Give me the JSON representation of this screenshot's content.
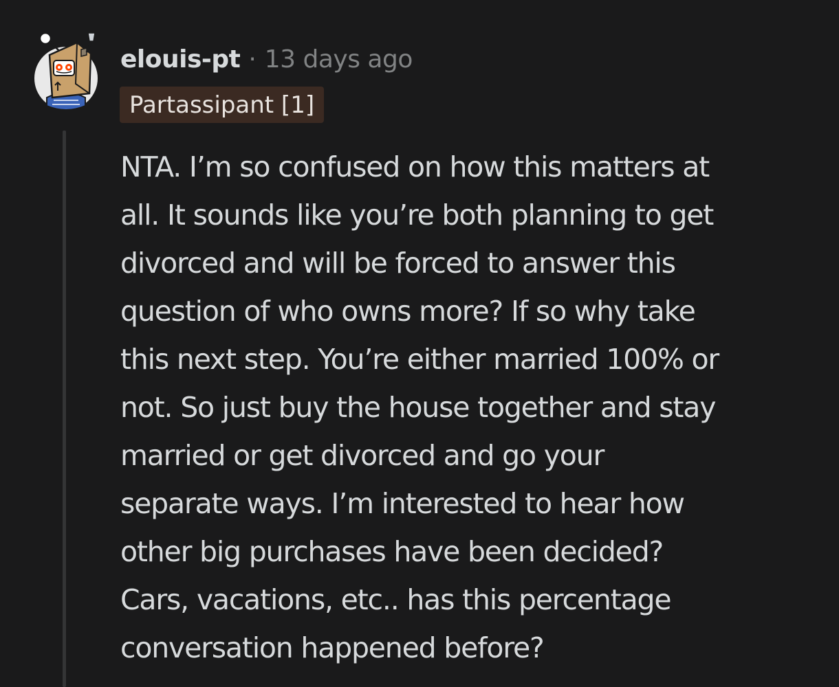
{
  "comment": {
    "author": "elouis-pt",
    "separator": "·",
    "time_ago": "13 days ago",
    "flair": "Partassipant [1]",
    "avatar_icon": "snoo-box-head-avatar-icon",
    "body_lines": [
      "NTA. I’m so confused on how this matters at",
      "all. It sounds like you’re both planning to get",
      "divorced and will be forced to answer this",
      "question of who owns more? If so why take",
      "this next step. You’re either married 100% or",
      "not. So just buy the house together and stay",
      "married or get divorced and go your",
      "separate ways. I’m interested to hear how",
      "other big purchases have been decided?",
      "Cars, vacations, etc.. has this percentage",
      "conversation happened before?"
    ]
  },
  "colors": {
    "background": "#1a1a1b",
    "text": "#d7dadc",
    "meta": "#818384",
    "flair_bg": "#3b2a22",
    "thread_line": "#343536"
  }
}
